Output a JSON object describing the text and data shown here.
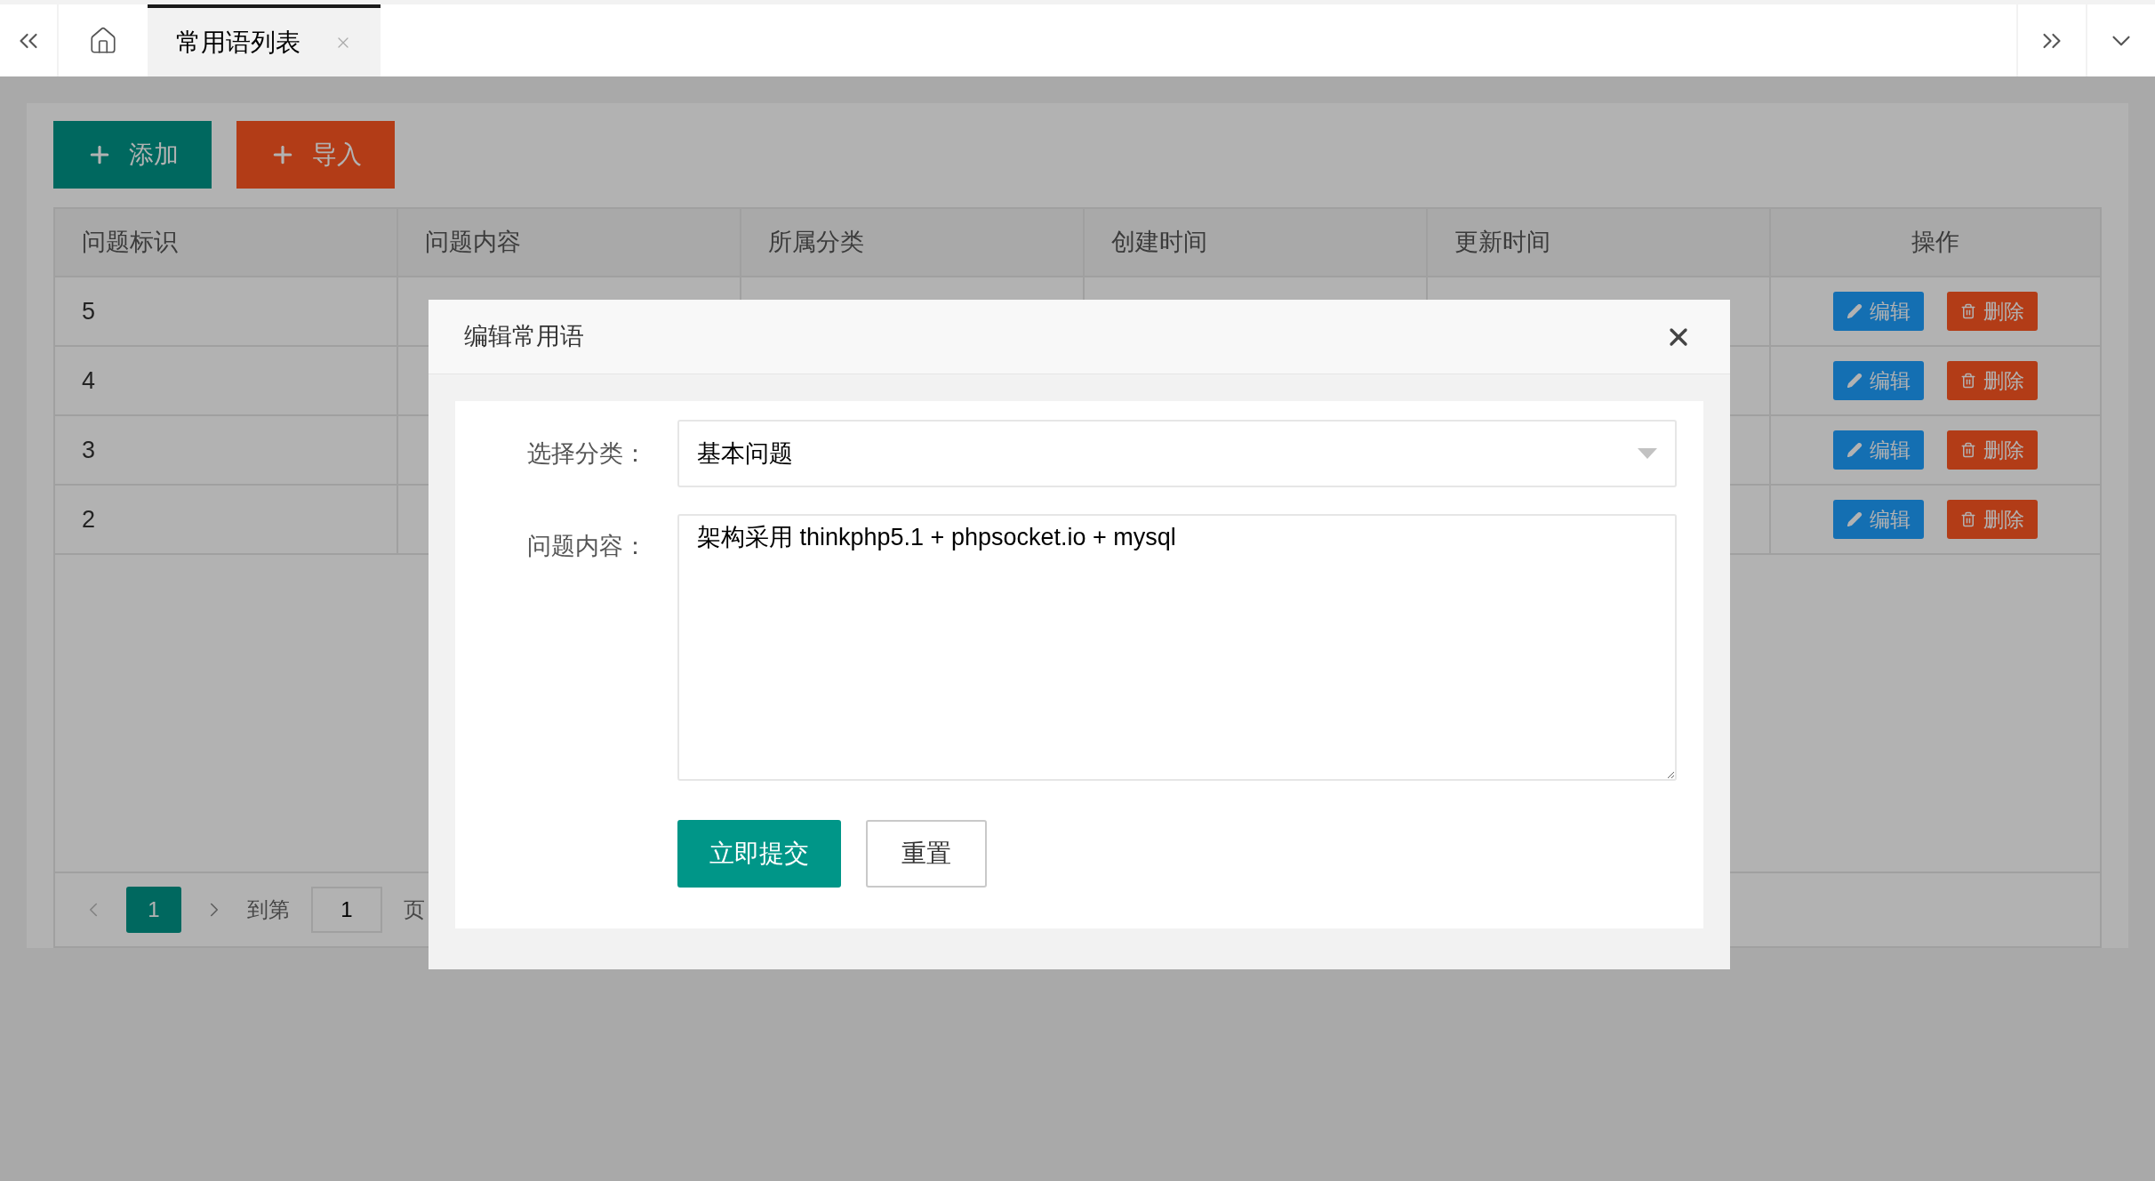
{
  "tab_bar": {
    "tabs": [
      {
        "label": "常用语列表",
        "selected": true
      }
    ]
  },
  "toolbar": {
    "buttons": [
      {
        "label": "添加",
        "kind": "add"
      },
      {
        "label": "导入",
        "kind": "import"
      }
    ]
  },
  "table": {
    "columns": [
      "问题标识",
      "问题内容",
      "所属分类",
      "创建时间",
      "更新时间",
      "操作"
    ],
    "rows": [
      {
        "id": "5",
        "actions": [
          "编辑",
          "删除"
        ]
      },
      {
        "id": "4",
        "actions": [
          "编辑",
          "删除"
        ]
      },
      {
        "id": "3",
        "actions": [
          "编辑",
          "删除"
        ]
      },
      {
        "id": "2",
        "actions": [
          "编辑",
          "删除"
        ]
      }
    ]
  },
  "pagination": {
    "pages": [
      {
        "label": "1",
        "selected": true
      }
    ],
    "goto_label": "到第",
    "goto_value": "1",
    "page_suffix": "页"
  },
  "modal": {
    "title": "编辑常用语",
    "fields": [
      {
        "label": "选择分类：",
        "kind": "select",
        "value": "基本问题"
      },
      {
        "label": "问题内容：",
        "kind": "textarea",
        "value": "架构采用 thinkphp5.1 + phpsocket.io + mysql"
      }
    ],
    "buttons": [
      {
        "label": "立即提交",
        "kind": "primary"
      },
      {
        "label": "重置",
        "kind": "secondary"
      }
    ]
  }
}
